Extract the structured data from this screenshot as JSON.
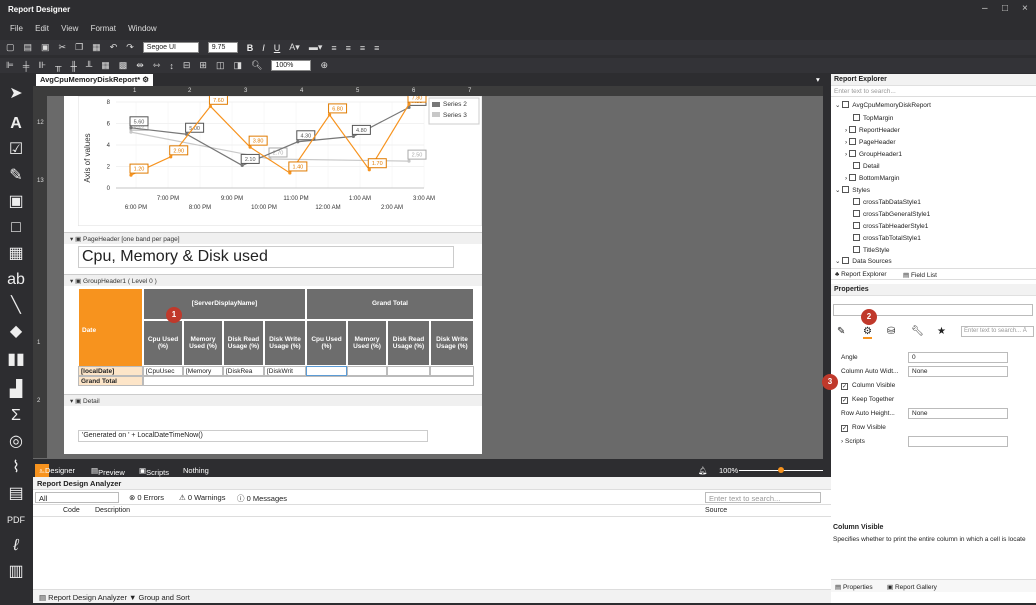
{
  "app": {
    "title": "Report Designer",
    "min": "–",
    "max": "□",
    "close": "×"
  },
  "menu": [
    "File",
    "Edit",
    "View",
    "Format",
    "Window"
  ],
  "toolbar": {
    "font": "Segoe UI",
    "size": "9.75",
    "bold": "B",
    "italic": "I",
    "underline": "U",
    "zoom": "100%"
  },
  "doc_tab": {
    "label": "AvgCpuMemoryDiskReport*"
  },
  "ruler": {
    "marks": [
      "1",
      "2",
      "3",
      "4",
      "5",
      "6",
      "7"
    ]
  },
  "vruler": {
    "marks": [
      "12",
      "13",
      "1",
      "2"
    ]
  },
  "chart": {
    "ylabel": "Axis of values",
    "yticks": [
      "8",
      "6",
      "4",
      "2",
      "0"
    ],
    "xticks_top": [
      "7:00 PM",
      "9:00 PM",
      "11:00 PM",
      "1:00 AM",
      "3:00 AM"
    ],
    "xticks_bottom": [
      "6:00 PM",
      "8:00 PM",
      "10:00 PM",
      "12:00 AM",
      "2:00 AM"
    ],
    "legend": [
      "Series 2",
      "Series 3"
    ],
    "labels_orange": [
      "1.20",
      "2.90",
      "7.60",
      "3.80",
      "1.40",
      "6.80",
      "1.70",
      "7.80"
    ],
    "labels_gray": [
      "5.60",
      "5.00",
      "2.10",
      "4.30",
      "4.80",
      "7.50"
    ],
    "labels_light": [
      "5.20",
      "2.70",
      "2.50"
    ]
  },
  "bands": {
    "page_header": "PageHeader [one band per page]",
    "group_header": "GroupHeader1 ( Level 0 )",
    "detail": "Detail"
  },
  "report_title": "Cpu, Memory & Disk used",
  "crosstab": {
    "date_header": "Date",
    "server_header": "[ServerDisplayName]",
    "grand_total_header": "Grand Total",
    "cols": [
      "Cpu Used (%)",
      "Memory Used (%)",
      "Disk Read Usage (%)",
      "Disk Write Usage (%)",
      "Cpu Used (%)",
      "Memory Used (%)",
      "Disk Read Usage (%)",
      "Disk Write Usage (%)"
    ],
    "row_label": "[localDate]",
    "grand_total_row": "Grand Total",
    "cells": [
      "[CpuUsec",
      "[Memory",
      "[DiskRea",
      "[DiskWrit"
    ]
  },
  "footer_expr": "'Generated on ' + LocalDateTimeNow()",
  "bottom_tabs": {
    "designer": "Designer",
    "preview": "Preview",
    "scripts": "Scripts",
    "nothing": "Nothing",
    "zoom": "100%"
  },
  "analyzer": {
    "title": "Report Design Analyzer",
    "filter": "All",
    "errors": "0 Errors",
    "warnings": "0 Warnings",
    "messages": "0 Messages",
    "search_placeholder": "Enter text to search...",
    "col_code": "Code",
    "col_desc": "Description",
    "col_source": "Source",
    "tab1": "Report Design Analyzer",
    "tab2": "Group and Sort"
  },
  "explorer": {
    "title": "Report Explorer",
    "search_placeholder": "Enter text to search...",
    "items": [
      "AvgCpuMemoryDiskReport",
      "TopMargin",
      "ReportHeader",
      "PageHeader",
      "GroupHeader1",
      "Detail",
      "BottomMargin",
      "Styles",
      "crossTabDataStyle1",
      "crossTabGeneralStyle1",
      "crossTabHeaderStyle1",
      "crossTabTotalStyle1",
      "TitleStyle",
      "Data Sources"
    ],
    "tab1": "Report Explorer",
    "tab2": "Field List"
  },
  "properties": {
    "title": "Properties",
    "search_placeholder": "Enter text to search... Å",
    "angle_label": "Angle",
    "angle_value": "0",
    "caw_label": "Column Auto Widt...",
    "caw_value": "None",
    "column_visible": "Column Visible",
    "keep_together": "Keep Together",
    "rah_label": "Row Auto Height...",
    "rah_value": "None",
    "row_visible": "Row Visible",
    "scripts": "Scripts",
    "desc_title": "Column Visible",
    "desc_text": "Specifies whether to print the entire column in which a cell is locate",
    "tab1": "Properties",
    "tab2": "Report Gallery"
  },
  "badges": [
    "1",
    "2",
    "3"
  ]
}
